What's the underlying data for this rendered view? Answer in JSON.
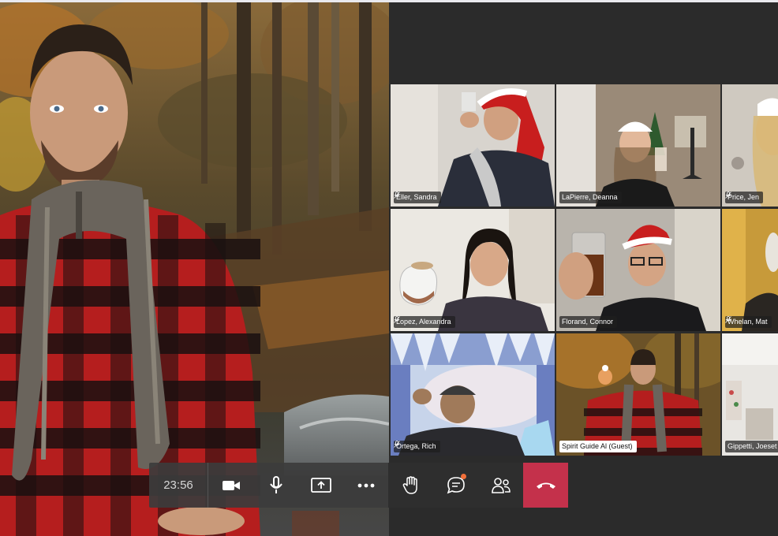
{
  "call": {
    "timer": "23:56"
  },
  "participants": [
    {
      "name": "Eller, Sandra",
      "muted": true
    },
    {
      "name": "LaPierre, Deanna",
      "muted": false
    },
    {
      "name": "Price, Jen",
      "muted": true
    },
    {
      "name": "Lopez, Alexandra",
      "muted": true
    },
    {
      "name": "Florand, Connor",
      "muted": false
    },
    {
      "name": "Whelan, Mat",
      "muted": true
    },
    {
      "name": "Ortega, Rich",
      "muted": true
    },
    {
      "name": "Spirit Guide Al (Guest)",
      "muted": false
    },
    {
      "name": "Gippetti, Joeset",
      "muted": false
    }
  ],
  "controls": {
    "camera_icon": "video-camera-icon",
    "mic_icon": "microphone-icon",
    "share_icon": "share-screen-icon",
    "more_icon": "more-options-icon",
    "raise_hand_icon": "raise-hand-icon",
    "chat_icon": "chat-icon",
    "participants_icon": "participants-icon",
    "hangup_icon": "hang-up-icon"
  },
  "colors": {
    "hangup": "#c4314b",
    "chat_badge": "#f2703a",
    "panel": "#2b2b2b"
  }
}
